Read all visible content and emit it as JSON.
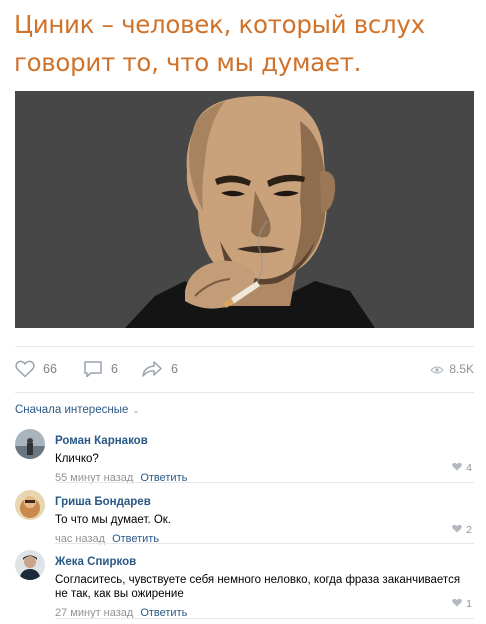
{
  "post": {
    "caption_line1": "Циник – человек, который вслух",
    "caption_line2": "говорит то, что мы думает."
  },
  "actions": {
    "likes": "66",
    "comments": "6",
    "shares": "6",
    "views": "8.5K"
  },
  "comments_section": {
    "sort_label": "Сначала интересные",
    "items": [
      {
        "author": "Роман Карнаков",
        "text": "Кличко?",
        "time": "55 минут назад",
        "reply": "Ответить",
        "likes": "4"
      },
      {
        "author": "Гриша Бондарев",
        "text": "То что мы думает. Ок.",
        "time": "час назад",
        "reply": "Ответить",
        "likes": "2"
      },
      {
        "author": "Жека Спирков",
        "text_line1": "Согласитесь, чувствуете себя немного неловко, когда фраза заканчивается",
        "text_line2": "не так, как вы ожирение",
        "time": "27 минут назад",
        "reply": "Ответить",
        "likes": "1"
      }
    ]
  },
  "colors": {
    "caption": "#d07229",
    "link": "#2a5885",
    "muted": "#939393",
    "image_bg": "#474747"
  }
}
